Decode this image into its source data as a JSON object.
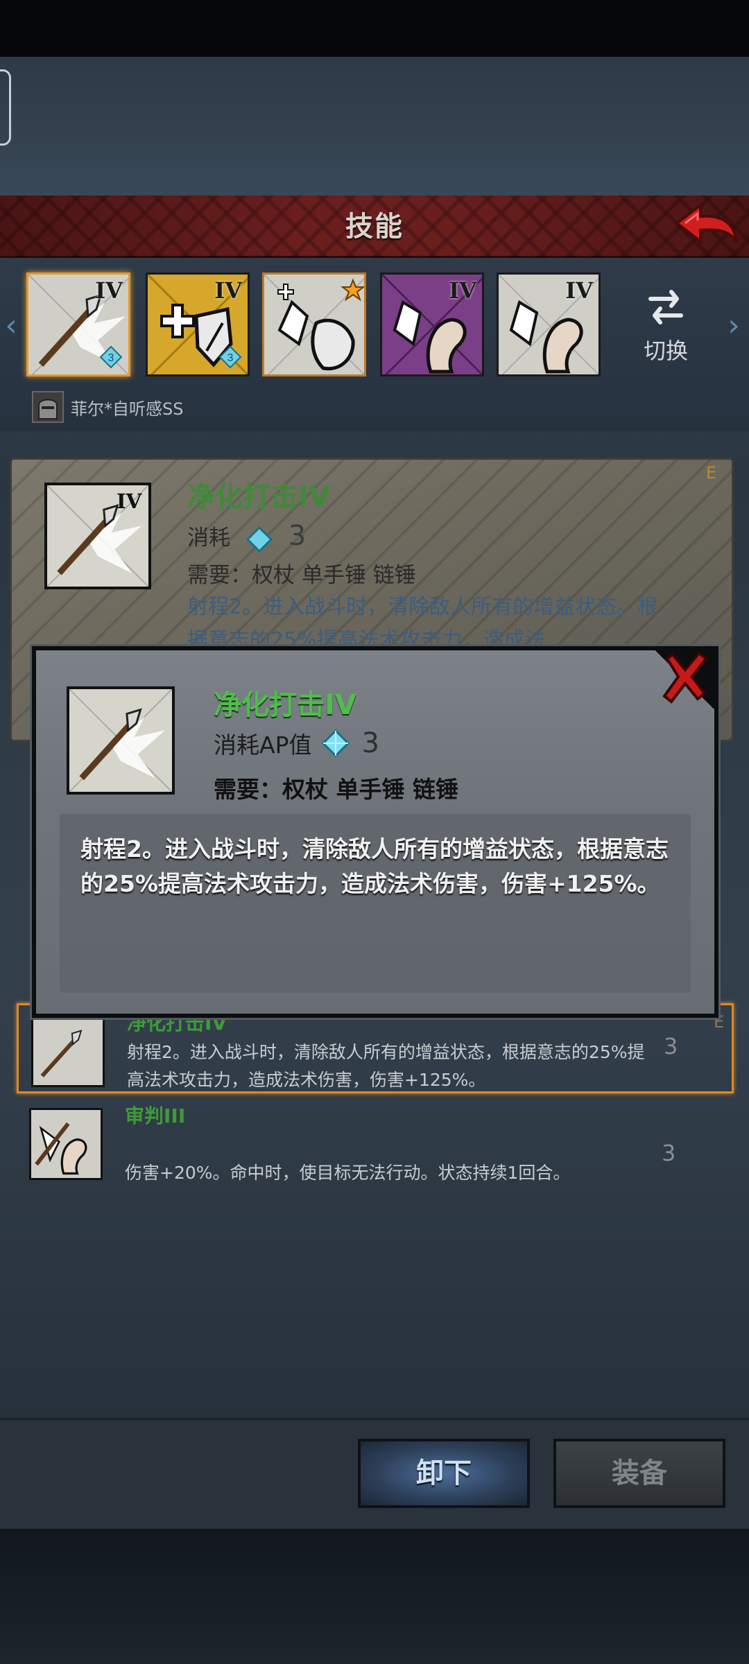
{
  "header": {
    "title": "技能"
  },
  "skill_slots": [
    {
      "rank": "IV",
      "badge": "3",
      "selected": true,
      "theme": "#cfcfc8"
    },
    {
      "rank": "IV",
      "badge": "3",
      "selected": false,
      "theme": "#d6a72a"
    },
    {
      "rank": "",
      "badge": "",
      "selected": false,
      "theme": "#cfcfc8",
      "star": true
    },
    {
      "rank": "IV",
      "badge": "",
      "selected": false,
      "theme": "#7a3f86"
    },
    {
      "rank": "IV",
      "badge": "",
      "selected": false,
      "theme": "#cfcfc8"
    }
  ],
  "switch_label": "切换",
  "character": {
    "name": "菲尔*自听感SS"
  },
  "background_card": {
    "title": "净化打击IV",
    "cost_label": "消耗",
    "cost_value": "3",
    "requirement": "需要：权杖 单手锤 链锤",
    "desc": "射程2。进入战斗时，清除敌人所有的增益状态。根据意志的25%提高法术攻击力，造成法",
    "grade": "E"
  },
  "modal": {
    "title": "净化打击IV",
    "cost_label": "消耗AP值",
    "cost_value": "3",
    "requirement": "需要：权杖 单手锤 链锤",
    "description": "射程2。进入战斗时，清除敌人所有的增益状态，根据意志的25%提高法术攻击力，造成法术伤害，伤害+125%。"
  },
  "skill_list": [
    {
      "name": "净化打击IV",
      "desc": "射程2。进入战斗时，清除敌人所有的增益状态，根据意志的25%提高法术攻击力，造成法术伤害，伤害+125%。",
      "cost": "3",
      "grade": "E",
      "selected": true
    },
    {
      "name": "审判III",
      "desc": "伤害+20%。命中时，使目标无法行动。状态持续1回合。",
      "cost": "3",
      "grade": "",
      "selected": false
    }
  ],
  "buttons": {
    "unequip": "卸下",
    "equip": "装备"
  },
  "colors": {
    "accent_orange": "#e39a2a",
    "title_green": "#4fbe4b",
    "header_red": "#6a1e1e",
    "close_red": "#c61a1a"
  },
  "icons": {
    "back": "red-arrow-back-icon",
    "close": "red-x-close-icon",
    "switch": "swap-arrows-icon",
    "gem": "blue-diamond-gem-icon"
  }
}
